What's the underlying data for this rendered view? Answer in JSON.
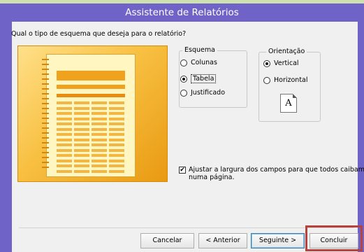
{
  "window": {
    "title": "Assistente de Relatórios"
  },
  "question": "Qual o tipo de esquema que deseja para o relatório?",
  "esquema": {
    "title": "Esquema",
    "options": [
      {
        "label": "Colunas",
        "selected": false
      },
      {
        "label": "Tabela",
        "selected": true
      },
      {
        "label": "Justificado",
        "selected": false
      }
    ]
  },
  "orientacao": {
    "title": "Orientação",
    "options": [
      {
        "label": "Vertical",
        "selected": true
      },
      {
        "label": "Horizontal",
        "selected": false
      }
    ],
    "preview_letter": "A"
  },
  "checkbox": {
    "label": "Ajustar a largura dos campos para que todos caibam numa página.",
    "checked": true
  },
  "buttons": {
    "cancel": "Cancelar",
    "back": "< Anterior",
    "next": "Seguinte >",
    "finish": "Concluir"
  },
  "colors": {
    "title_bar": "#6f63c7",
    "artwork": "#f8c042",
    "highlight": "#b8423d"
  }
}
